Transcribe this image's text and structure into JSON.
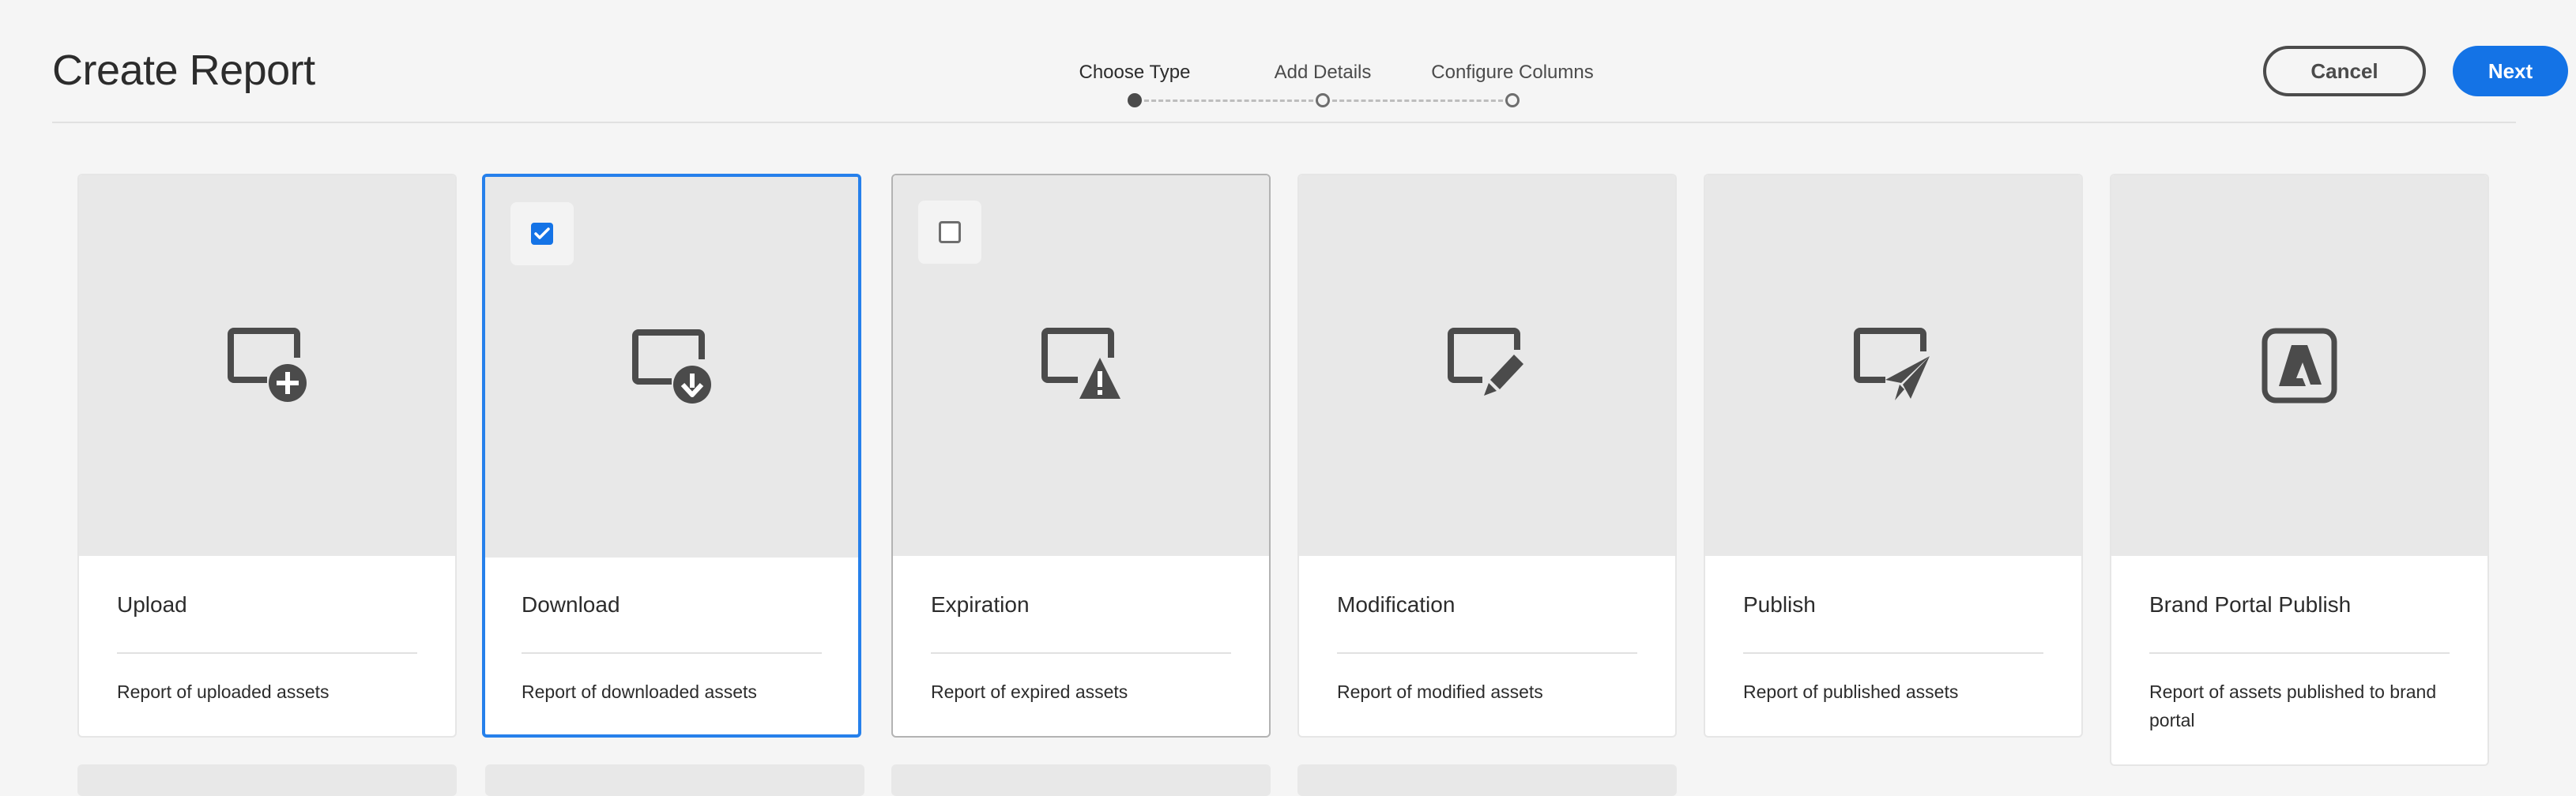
{
  "page": {
    "title": "Create Report"
  },
  "stepper": {
    "steps": [
      {
        "label": "Choose Type",
        "state": "current"
      },
      {
        "label": "Add Details",
        "state": "pending"
      },
      {
        "label": "Configure Columns",
        "state": "pending"
      }
    ]
  },
  "actions": {
    "cancel_label": "Cancel",
    "next_label": "Next"
  },
  "colors": {
    "accent": "#1473e6",
    "selected_border": "#2680eb",
    "icon": "#4b4b4b"
  },
  "cards": [
    {
      "title": "Upload",
      "description": "Report of uploaded assets",
      "icon": "upload-report-icon",
      "checked": false
    },
    {
      "title": "Download",
      "description": "Report of downloaded assets",
      "icon": "download-report-icon",
      "checked": true
    },
    {
      "title": "Expiration",
      "description": "Report of expired assets",
      "icon": "expiration-report-icon",
      "checked": false
    },
    {
      "title": "Modification",
      "description": "Report of modified assets",
      "icon": "modification-report-icon",
      "checked": false
    },
    {
      "title": "Publish",
      "description": "Report of published assets",
      "icon": "publish-report-icon",
      "checked": false
    },
    {
      "title": "Brand Portal Publish",
      "description": "Report of assets published to brand portal",
      "icon": "brand-portal-icon",
      "checked": false
    }
  ]
}
